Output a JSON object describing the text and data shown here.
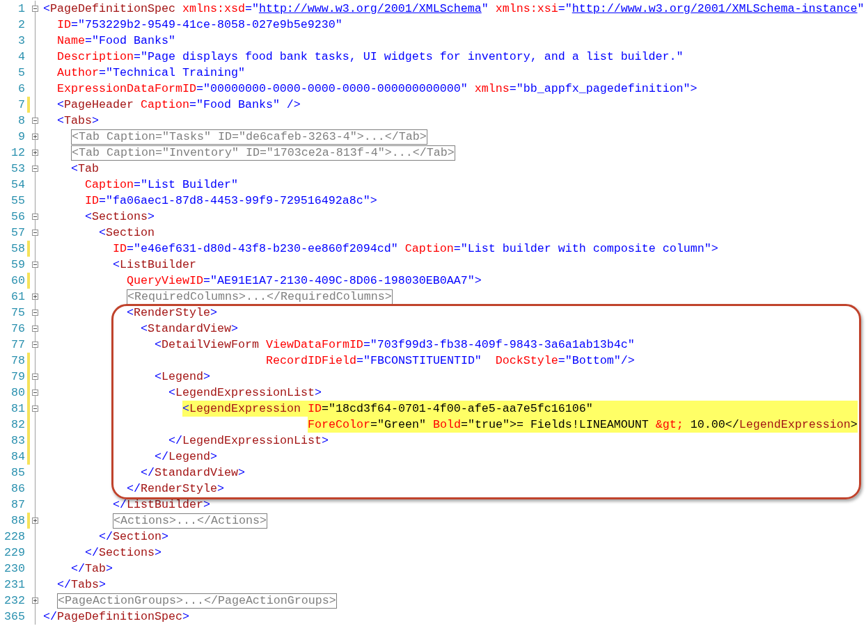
{
  "editor": {
    "lines": [
      {
        "kind": "line",
        "number": "1",
        "expanded": true,
        "tokens": [
          {
            "kind": "punct",
            "text": "<"
          },
          {
            "kind": "tag",
            "text": "PageDefinitionSpec"
          },
          {
            "kind": "attr",
            "text": " xmlns:xsd"
          },
          {
            "kind": "punct",
            "text": "=\""
          },
          {
            "kind": "link",
            "text": "http://www.w3.org/2001/XMLSchema"
          },
          {
            "kind": "punct",
            "text": "\" "
          },
          {
            "kind": "attr",
            "text": "xmlns:xsi"
          },
          {
            "kind": "punct",
            "text": "=\""
          },
          {
            "kind": "link",
            "text": "http://www.w3.org/2001/XMLSchema-instance"
          },
          {
            "kind": "punct",
            "text": "\""
          }
        ]
      },
      {
        "kind": "line",
        "number": "2",
        "tokens": [
          {
            "kind": "attr",
            "text": "  ID"
          },
          {
            "kind": "value",
            "text": "=\"753229b2-9549-41ce-8058-027e9b5e9230\""
          }
        ]
      },
      {
        "kind": "line",
        "number": "3",
        "tokens": [
          {
            "kind": "attr",
            "text": "  Name"
          },
          {
            "kind": "value",
            "text": "=\"Food Banks\""
          }
        ]
      },
      {
        "kind": "line",
        "number": "4",
        "tokens": [
          {
            "kind": "attr",
            "text": "  Description"
          },
          {
            "kind": "value",
            "text": "=\"Page displays food bank tasks, UI widgets for inventory, and a list builder.\""
          }
        ]
      },
      {
        "kind": "line",
        "number": "5",
        "tokens": [
          {
            "kind": "attr",
            "text": "  Author"
          },
          {
            "kind": "value",
            "text": "=\"Technical Training\""
          }
        ]
      },
      {
        "kind": "line",
        "number": "6",
        "tokens": [
          {
            "kind": "attr",
            "text": "  ExpressionDataFormID"
          },
          {
            "kind": "value",
            "text": "=\"00000000-0000-0000-0000-000000000000\""
          },
          {
            "kind": "attr",
            "text": " xmlns"
          },
          {
            "kind": "value",
            "text": "=\"bb_appfx_pagedefinition\">"
          }
        ]
      },
      {
        "kind": "line",
        "number": "7",
        "changed": true,
        "tokens": [
          {
            "kind": "punct",
            "text": "  <"
          },
          {
            "kind": "tag",
            "text": "PageHeader"
          },
          {
            "kind": "attr",
            "text": " Caption"
          },
          {
            "kind": "value",
            "text": "=\"Food Banks\" />"
          }
        ]
      },
      {
        "kind": "line",
        "number": "8",
        "expanded": true,
        "tokens": [
          {
            "kind": "punct",
            "text": "  <"
          },
          {
            "kind": "tag",
            "text": "Tabs"
          },
          {
            "kind": "punct",
            "text": ">"
          }
        ]
      },
      {
        "kind": "line",
        "number": "9",
        "expanded": false,
        "tokens": [
          {
            "kind": "collapsed",
            "text": "    <Tab Caption=\"Tasks\" ID=\"de6cafeb-3263-4\">...</Tab>"
          }
        ]
      },
      {
        "kind": "line",
        "number": "12",
        "expanded": false,
        "tokens": [
          {
            "kind": "collapsed",
            "text": "    <Tab Caption=\"Inventory\" ID=\"1703ce2a-813f-4\">...</Tab>"
          }
        ]
      },
      {
        "kind": "line",
        "number": "53",
        "expanded": true,
        "tokens": [
          {
            "kind": "punct",
            "text": "    <"
          },
          {
            "kind": "tag",
            "text": "Tab"
          }
        ]
      },
      {
        "kind": "line",
        "number": "54",
        "tokens": [
          {
            "kind": "attr",
            "text": "      Caption"
          },
          {
            "kind": "value",
            "text": "=\"List Builder\""
          }
        ]
      },
      {
        "kind": "line",
        "number": "55",
        "tokens": [
          {
            "kind": "attr",
            "text": "      ID"
          },
          {
            "kind": "value",
            "text": "=\"fa06aec1-87d8-4453-99f9-729516492a8c\">"
          }
        ]
      },
      {
        "kind": "line",
        "number": "56",
        "expanded": true,
        "tokens": [
          {
            "kind": "punct",
            "text": "      <"
          },
          {
            "kind": "tag",
            "text": "Sections"
          },
          {
            "kind": "punct",
            "text": ">"
          }
        ]
      },
      {
        "kind": "line",
        "number": "57",
        "expanded": true,
        "tokens": [
          {
            "kind": "punct",
            "text": "        <"
          },
          {
            "kind": "tag",
            "text": "Section"
          }
        ]
      },
      {
        "kind": "line",
        "number": "58",
        "changed": true,
        "tokens": [
          {
            "kind": "attr",
            "text": "          ID"
          },
          {
            "kind": "value",
            "text": "=\"e46ef631-d80d-43f8-b230-ee860f2094cd\""
          },
          {
            "kind": "attr",
            "text": " Caption"
          },
          {
            "kind": "value",
            "text": "=\"List builder with composite column\">"
          }
        ]
      },
      {
        "kind": "line",
        "number": "59",
        "expanded": true,
        "tokens": [
          {
            "kind": "punct",
            "text": "          <"
          },
          {
            "kind": "tag",
            "text": "ListBuilder"
          }
        ]
      },
      {
        "kind": "line",
        "number": "60",
        "changed": true,
        "tokens": [
          {
            "kind": "attr",
            "text": "            QueryViewID"
          },
          {
            "kind": "value",
            "text": "=\"AE91E1A7-2130-409C-8D06-198030EB0AA7\">"
          }
        ]
      },
      {
        "kind": "line",
        "number": "61",
        "expanded": false,
        "tokens": [
          {
            "kind": "collapsed",
            "text": "            <RequiredColumns>...</RequiredColumns>"
          }
        ]
      },
      {
        "kind": "callout",
        "lines": [
          {
            "kind": "line",
            "number": "75",
            "expanded": true,
            "tokens": [
              {
                "kind": "punct",
                "text": "            <"
              },
              {
                "kind": "tag",
                "text": "RenderStyle"
              },
              {
                "kind": "punct",
                "text": ">"
              }
            ]
          },
          {
            "kind": "line",
            "number": "76",
            "expanded": true,
            "tokens": [
              {
                "kind": "punct",
                "text": "              <"
              },
              {
                "kind": "tag",
                "text": "StandardView"
              },
              {
                "kind": "punct",
                "text": ">"
              }
            ]
          },
          {
            "kind": "line",
            "number": "77",
            "expanded": true,
            "tokens": [
              {
                "kind": "punct",
                "text": "                <"
              },
              {
                "kind": "tag",
                "text": "DetailViewForm"
              },
              {
                "kind": "attr",
                "text": " ViewDataFormID"
              },
              {
                "kind": "value",
                "text": "=\"703f99d3-fb38-409f-9843-3a6a1ab13b4c\""
              }
            ]
          },
          {
            "kind": "line",
            "number": "78",
            "changed": true,
            "tokens": [
              {
                "kind": "attr",
                "text": "                                RecordIDField"
              },
              {
                "kind": "value",
                "text": "=\"FBCONSTITUENTID\""
              },
              {
                "kind": "attr",
                "text": "  DockStyle"
              },
              {
                "kind": "value",
                "text": "=\"Bottom\"/>"
              }
            ]
          },
          {
            "kind": "line",
            "number": "79",
            "changed": true,
            "expanded": true,
            "tokens": [
              {
                "kind": "punct",
                "text": "                <"
              },
              {
                "kind": "tag",
                "text": "Legend"
              },
              {
                "kind": "punct",
                "text": ">"
              }
            ]
          },
          {
            "kind": "line",
            "number": "80",
            "changed": true,
            "expanded": true,
            "tokens": [
              {
                "kind": "punct",
                "text": "                  <"
              },
              {
                "kind": "tag",
                "text": "LegendExpressionList"
              },
              {
                "kind": "punct",
                "text": ">"
              }
            ]
          },
          {
            "kind": "line",
            "number": "81",
            "changed": true,
            "highlighted": true,
            "expanded": true,
            "tokens": [
              {
                "kind": "punct",
                "text": "                    <"
              },
              {
                "kind": "tag",
                "text": "LegendExpression"
              },
              {
                "kind": "attr",
                "text": " ID"
              },
              {
                "kind": "text",
                "text": "=\"18cd3f64-0701-4f00-afe5-aa7e5fc16106\""
              }
            ]
          },
          {
            "kind": "line",
            "number": "82",
            "changed": true,
            "highlighted": true,
            "tokens": [
              {
                "kind": "attr",
                "text": "                                      ForeColor"
              },
              {
                "kind": "text",
                "text": "=\"Green\" "
              },
              {
                "kind": "attr",
                "text": "Bold"
              },
              {
                "kind": "text",
                "text": "=\"true\">= Fields!LINEAMOUNT "
              },
              {
                "kind": "entity",
                "text": "&gt;"
              },
              {
                "kind": "text",
                "text": " 10.00</"
              },
              {
                "kind": "tag",
                "text": "LegendExpression"
              },
              {
                "kind": "text",
                "text": ">"
              }
            ]
          },
          {
            "kind": "line",
            "number": "83",
            "changed": true,
            "tokens": [
              {
                "kind": "punct",
                "text": "                  </"
              },
              {
                "kind": "tag",
                "text": "LegendExpressionList"
              },
              {
                "kind": "punct",
                "text": ">"
              }
            ]
          },
          {
            "kind": "line",
            "number": "84",
            "changed": true,
            "tokens": [
              {
                "kind": "punct",
                "text": "                </"
              },
              {
                "kind": "tag",
                "text": "Legend"
              },
              {
                "kind": "punct",
                "text": ">"
              }
            ]
          },
          {
            "kind": "line",
            "number": "85",
            "tokens": [
              {
                "kind": "punct",
                "text": "              </"
              },
              {
                "kind": "tag",
                "text": "StandardView"
              },
              {
                "kind": "punct",
                "text": ">"
              }
            ]
          },
          {
            "kind": "line",
            "number": "86",
            "tokens": [
              {
                "kind": "punct",
                "text": "            </"
              },
              {
                "kind": "tag",
                "text": "RenderStyle"
              },
              {
                "kind": "punct",
                "text": ">"
              }
            ]
          }
        ]
      },
      {
        "kind": "line",
        "number": "87",
        "tokens": [
          {
            "kind": "punct",
            "text": "          </"
          },
          {
            "kind": "tag",
            "text": "ListBuilder"
          },
          {
            "kind": "punct",
            "text": ">"
          }
        ]
      },
      {
        "kind": "line",
        "number": "88",
        "changed": true,
        "expanded": false,
        "tokens": [
          {
            "kind": "collapsed",
            "text": "          <Actions>...</Actions>"
          }
        ]
      },
      {
        "kind": "line",
        "number": "228",
        "tokens": [
          {
            "kind": "punct",
            "text": "        </"
          },
          {
            "kind": "tag",
            "text": "Section"
          },
          {
            "kind": "punct",
            "text": ">"
          }
        ]
      },
      {
        "kind": "line",
        "number": "229",
        "tokens": [
          {
            "kind": "punct",
            "text": "      </"
          },
          {
            "kind": "tag",
            "text": "Sections"
          },
          {
            "kind": "punct",
            "text": ">"
          }
        ]
      },
      {
        "kind": "line",
        "number": "230",
        "tokens": [
          {
            "kind": "punct",
            "text": "    </"
          },
          {
            "kind": "tag",
            "text": "Tab"
          },
          {
            "kind": "punct",
            "text": ">"
          }
        ]
      },
      {
        "kind": "line",
        "number": "231",
        "tokens": [
          {
            "kind": "punct",
            "text": "  </"
          },
          {
            "kind": "tag",
            "text": "Tabs"
          },
          {
            "kind": "punct",
            "text": ">"
          }
        ]
      },
      {
        "kind": "line",
        "number": "232",
        "expanded": false,
        "tokens": [
          {
            "kind": "collapsed",
            "text": "  <PageActionGroups>...</PageActionGroups>"
          }
        ]
      },
      {
        "kind": "line",
        "number": "365",
        "tokens": [
          {
            "kind": "punct",
            "text": "</"
          },
          {
            "kind": "tag",
            "text": "PageDefinitionSpec"
          },
          {
            "kind": "punct",
            "text": ">"
          }
        ]
      }
    ]
  }
}
